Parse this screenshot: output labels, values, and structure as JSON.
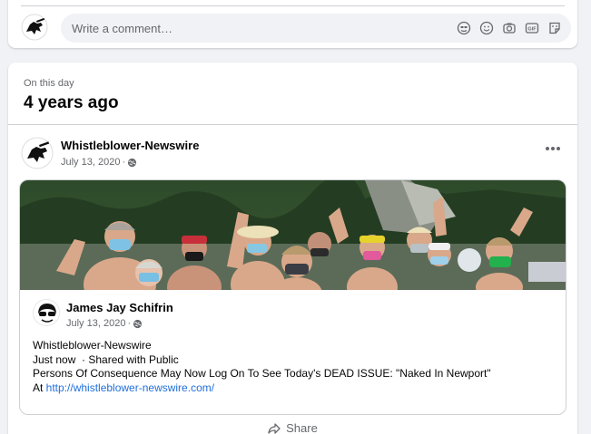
{
  "comment": {
    "placeholder": "Write a comment…",
    "icons": [
      "gif-icon",
      "emoji-icon",
      "camera-icon",
      "gif-sticker-icon",
      "sticker-icon"
    ]
  },
  "memory": {
    "label": "On this day",
    "title": "4 years ago"
  },
  "post": {
    "author": "Whistleblower-Newswire",
    "date": "July 13, 2020",
    "separator": "·",
    "privacy_icon": "globe-icon"
  },
  "shared": {
    "author": "James Jay Schifrin",
    "date": "July 13, 2020",
    "separator": "·",
    "lines": [
      "Whistleblower-Newswire",
      "Just now  · Shared with Public",
      "Persons Of Consequence May Now Log On To See Today's DEAD ISSUE: \"Naked In Newport\""
    ],
    "link_prefix": "At ",
    "link": "http://whistleblower-newswire.com/"
  },
  "actions": {
    "share": "Share"
  },
  "colors": {
    "background": "#f0f2f5",
    "card": "#ffffff",
    "secondary_text": "#65676b",
    "link": "#216fdb"
  }
}
